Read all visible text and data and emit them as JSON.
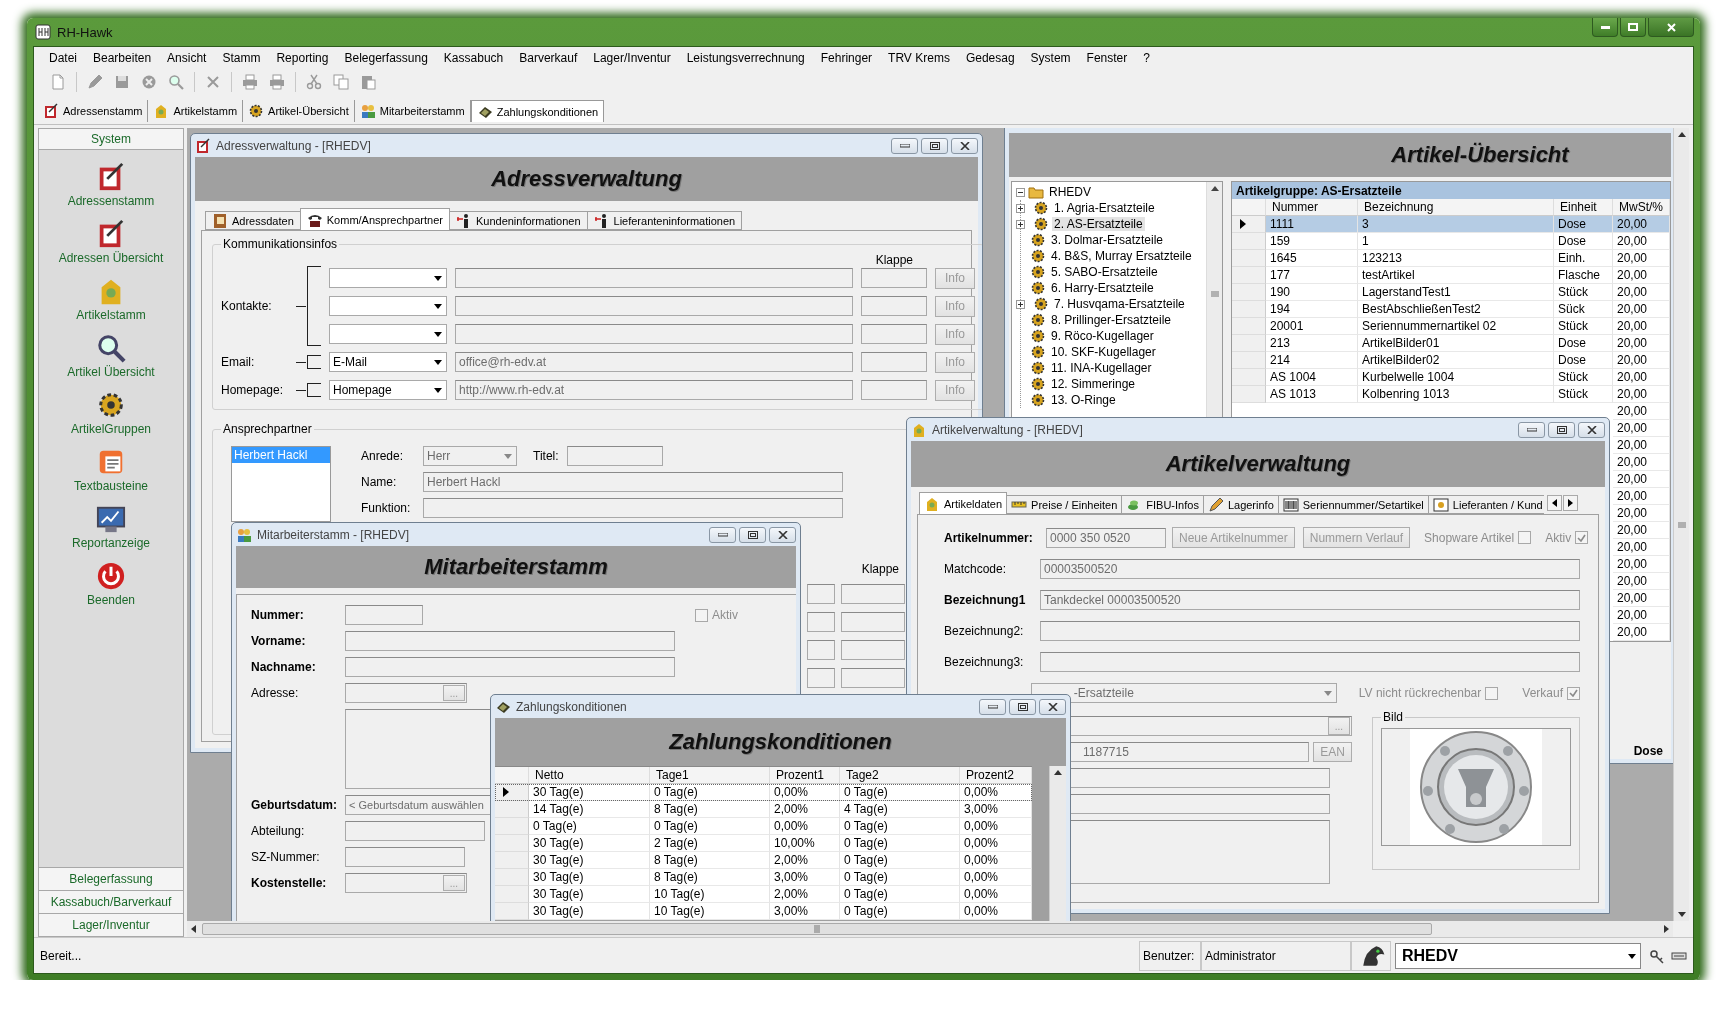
{
  "window": {
    "title": "RH-Hawk"
  },
  "menu": [
    "Datei",
    "Bearbeiten",
    "Ansicht",
    "Stamm",
    "Reporting",
    "Belegerfassung",
    "Kassabuch",
    "Barverkauf",
    "Lager/Inventur",
    "Leistungsverrechnung",
    "Fehringer",
    "TRV Krems",
    "Gedesag",
    "System",
    "Fenster",
    "?"
  ],
  "doc_tabs": [
    {
      "label": "Adressenstamm",
      "kind": "address",
      "selected": false
    },
    {
      "label": "Artikelstamm",
      "kind": "article",
      "selected": false
    },
    {
      "label": "Artikel-Übersicht",
      "kind": "gears",
      "selected": false
    },
    {
      "label": "Mitarbeiterstamm",
      "kind": "staff",
      "selected": false
    },
    {
      "label": "Zahlungskonditionen",
      "kind": "cash",
      "selected": true
    }
  ],
  "sidebar": {
    "header": "System",
    "items": [
      {
        "label": "Adressenstamm",
        "kind": "address"
      },
      {
        "label": "Adressen Übersicht",
        "kind": "address"
      },
      {
        "label": "Artikelstamm",
        "kind": "article"
      },
      {
        "label": "Artikel Übersicht",
        "kind": "search"
      },
      {
        "label": "ArtikelGruppen",
        "kind": "gears"
      },
      {
        "label": "Textbausteine",
        "kind": "text"
      },
      {
        "label": "Reportanzeige",
        "kind": "report"
      },
      {
        "label": "Beenden",
        "kind": "power"
      }
    ],
    "sections": [
      "Belegerfassung",
      "Kassabuch/Barverkauf",
      "Lager/Inventur"
    ]
  },
  "adress_window": {
    "title": "Adressverwaltung - [RHEDV]",
    "heading": "Adressverwaltung",
    "tabs": [
      {
        "label": "Adressdaten",
        "kind": "book",
        "selected": false
      },
      {
        "label": "Komm/Ansprechpartner",
        "kind": "phone",
        "selected": true
      },
      {
        "label": "Kundeninformationen",
        "kind": "person",
        "selected": false
      },
      {
        "label": "Lieferanteninformationen",
        "kind": "person",
        "selected": false
      }
    ],
    "komm": {
      "legend": "Kommunikationsinfos",
      "klappe": "Klappe",
      "kontakte_label": "Kontakte:",
      "rows": [
        {
          "kind": "contact",
          "button": "Info"
        },
        {
          "kind": "contact",
          "button": "Info"
        },
        {
          "kind": "contact",
          "button": "Info"
        },
        {
          "kind": "single",
          "label": "Email:",
          "combo": "E-Mail",
          "value": "office@rh-edv.at",
          "button": "Info"
        },
        {
          "kind": "single",
          "label": "Homepage:",
          "combo": "Homepage",
          "value": "http://www.rh-edv.at",
          "button": "Info"
        }
      ]
    },
    "ansprechpartner": {
      "legend": "Ansprechpartner",
      "contacts": [
        {
          "label": "Herbert Hackl",
          "selected": true
        }
      ],
      "anrede_label": "Anrede:",
      "anrede": "Herr",
      "titel_label": "Titel:",
      "name_label": "Name:",
      "name": "Herbert Hackl",
      "funktion_label": "Funktion:",
      "klappe": "Klappe"
    }
  },
  "uebersicht_window": {
    "heading": "Artikel-Übersicht",
    "tree": {
      "label": "RHEDV",
      "expanded": true,
      "children": [
        {
          "label": "1. Agria-Ersatzteile",
          "expandable": true,
          "selected": false
        },
        {
          "label": "2. AS-Ersatzteile",
          "expandable": true,
          "selected": true
        },
        {
          "label": "3. Dolmar-Ersatzteile",
          "expandable": false,
          "selected": false
        },
        {
          "label": "4. B&S, Murray Ersatzteile",
          "expandable": false,
          "selected": false
        },
        {
          "label": "5. SABO-Ersatzteile",
          "expandable": false,
          "selected": false
        },
        {
          "label": "6. Harry-Ersatzteile",
          "expandable": false,
          "selected": false
        },
        {
          "label": "7. Husvqama-Ersatzteile",
          "expandable": true,
          "selected": false
        },
        {
          "label": "8. Prillinger-Ersatzteile",
          "expandable": false,
          "selected": false
        },
        {
          "label": "9. Röco-Kugellager",
          "expandable": false,
          "selected": false
        },
        {
          "label": "10. SKF-Kugellager",
          "expandable": false,
          "selected": false
        },
        {
          "label": "11. INA-Kugellager",
          "expandable": false,
          "selected": false
        },
        {
          "label": "12. Simmeringe",
          "expandable": false,
          "selected": false
        },
        {
          "label": "13. O-Ringe",
          "expandable": false,
          "selected": false
        }
      ]
    },
    "group_title": "Artikelgruppe: AS-Ersatzteile",
    "columns": [
      "Nummer",
      "Bezeichnung",
      "Einheit",
      "MwSt/%"
    ],
    "rows": [
      {
        "nummer": "1111",
        "bezeichnung": "3",
        "einheit": "Dose",
        "mwst": "20,00",
        "selected": true
      },
      {
        "nummer": "159",
        "bezeichnung": "1",
        "einheit": "Dose",
        "mwst": "20,00",
        "selected": false
      },
      {
        "nummer": "1645",
        "bezeichnung": "123213",
        "einheit": "Einh.",
        "mwst": "20,00",
        "selected": false
      },
      {
        "nummer": "177",
        "bezeichnung": "testArtikel",
        "einheit": "Flasche",
        "mwst": "20,00",
        "selected": false
      },
      {
        "nummer": "190",
        "bezeichnung": "LagerstandTest1",
        "einheit": "Stück",
        "mwst": "20,00",
        "selected": false
      },
      {
        "nummer": "194",
        "bezeichnung": "BestAbschließenTest2",
        "einheit": "Sück",
        "mwst": "20,00",
        "selected": false
      },
      {
        "nummer": "20001",
        "bezeichnung": "Seriennummernartikel 02",
        "einheit": "Stück",
        "mwst": "20,00",
        "selected": false
      },
      {
        "nummer": "213",
        "bezeichnung": "ArtikelBilder01",
        "einheit": "Dose",
        "mwst": "20,00",
        "selected": false
      },
      {
        "nummer": "214",
        "bezeichnung": "ArtikelBilder02",
        "einheit": "Dose",
        "mwst": "20,00",
        "selected": false
      },
      {
        "nummer": "AS 1004",
        "bezeichnung": "Kurbelwelle 1004",
        "einheit": "Stück",
        "mwst": "20,00",
        "selected": false
      },
      {
        "nummer": "AS 1013",
        "bezeichnung": "Kolbenring 1013",
        "einheit": "Stück",
        "mwst": "20,00",
        "selected": false
      },
      {
        "mwst": "20,00",
        "selected": false
      },
      {
        "mwst": "20,00",
        "selected": false
      },
      {
        "mwst": "20,00",
        "selected": false
      },
      {
        "mwst": "20,00",
        "selected": false
      },
      {
        "mwst": "20,00",
        "selected": false
      },
      {
        "mwst": "20,00",
        "selected": false
      },
      {
        "mwst": "20,00",
        "selected": false
      },
      {
        "mwst": "20,00",
        "selected": false
      },
      {
        "mwst": "20,00",
        "selected": false
      },
      {
        "mwst": "20,00",
        "selected": false
      },
      {
        "mwst": "20,00",
        "selected": false
      },
      {
        "mwst": "20,00",
        "selected": false
      },
      {
        "mwst": "20,00",
        "selected": false
      },
      {
        "mwst": "20,00",
        "selected": false
      }
    ],
    "footer": "Dose"
  },
  "mitarbeiter_window": {
    "title": "Mitarbeiterstamm - [RHEDV]",
    "heading": "Mitarbeiterstamm",
    "aktiv": {
      "label": "Aktiv",
      "checked": false
    },
    "fields": [
      {
        "label": "Nummer:",
        "bold": true,
        "kind": "short"
      },
      {
        "label": "Vorname:",
        "bold": true,
        "kind": "wide"
      },
      {
        "label": "Nachname:",
        "bold": true,
        "kind": "wide"
      },
      {
        "label": "Adresse:",
        "bold": false,
        "kind": "lookup",
        "button": "..."
      },
      {
        "kind": "memo"
      },
      {
        "label": "Geburtsdatum:",
        "bold": true,
        "kind": "date",
        "value": "< Geburtsdatum auswählen"
      },
      {
        "label": "Abteilung:",
        "bold": false,
        "kind": "wide"
      },
      {
        "label": "SZ-Nummer:",
        "bold": false,
        "kind": "short"
      },
      {
        "label": "Kostenstelle:",
        "bold": true,
        "kind": "lookup",
        "button": "..."
      }
    ]
  },
  "artikel_window": {
    "title": "Artikelverwaltung - [RHEDV]",
    "heading": "Artikelverwaltung",
    "tabs": [
      {
        "label": "Artikeldaten",
        "kind": "article",
        "selected": true
      },
      {
        "label": "Preise / Einheiten",
        "kind": "ruler",
        "selected": false
      },
      {
        "label": "FIBU-Infos",
        "kind": "coins",
        "selected": false
      },
      {
        "label": "Lagerinfo",
        "kind": "pencil",
        "selected": false
      },
      {
        "label": "Seriennummer/Setartikel",
        "kind": "barcode",
        "selected": false
      },
      {
        "label": "Lieferanten / Kund",
        "kind": "frame",
        "selected": false
      }
    ],
    "artikelnummer": {
      "label": "Artikelnummer:",
      "value": "0000 350 0520"
    },
    "buttons": [
      "Neue Artikelnummer",
      "Nummern Verlauf"
    ],
    "flags": [
      {
        "label": "Shopware Artikel",
        "checked": false
      },
      {
        "label": "Aktiv",
        "checked": true
      }
    ],
    "fields": [
      {
        "label": "Matchcode:",
        "value": "00003500520",
        "bold": false
      },
      {
        "label": "Bezeichnung1",
        "value": "Tankdeckel 00003500520",
        "bold": true
      },
      {
        "label": "Bezeichnung2:",
        "bold": false
      },
      {
        "label": "Bezeichnung3:",
        "bold": false
      }
    ],
    "gruppe": "-Ersatzteile",
    "flags2": [
      {
        "label": "LV nicht rückrechenbar",
        "checked": false
      },
      {
        "label": "Verkauf",
        "checked": true
      }
    ],
    "lookup_button": "...",
    "ean": {
      "value": "1187715",
      "button": "EAN"
    },
    "bild": {
      "legend": "Bild",
      "kind": "picture"
    }
  },
  "zahlungs_window": {
    "title": "Zahlungskonditionen",
    "heading": "Zahlungskonditionen",
    "columns": [
      "Netto",
      "Tage1",
      "Prozent1",
      "Tage2",
      "Prozent2"
    ],
    "rows": [
      {
        "cells": [
          "30 Tag(e)",
          "0 Tag(e)",
          "0,00%",
          "0 Tag(e)",
          "0,00%"
        ],
        "selected": true
      },
      {
        "cells": [
          "14 Tag(e)",
          "8 Tag(e)",
          "2,00%",
          "4 Tag(e)",
          "3,00%"
        ],
        "selected": false
      },
      {
        "cells": [
          "0 Tag(e)",
          "0 Tag(e)",
          "0,00%",
          "0 Tag(e)",
          "0,00%"
        ],
        "selected": false
      },
      {
        "cells": [
          "30 Tag(e)",
          "2 Tag(e)",
          "10,00%",
          "0 Tag(e)",
          "0,00%"
        ],
        "selected": false
      },
      {
        "cells": [
          "30 Tag(e)",
          "8 Tag(e)",
          "2,00%",
          "0 Tag(e)",
          "0,00%"
        ],
        "selected": false
      },
      {
        "cells": [
          "30 Tag(e)",
          "8 Tag(e)",
          "3,00%",
          "0 Tag(e)",
          "0,00%"
        ],
        "selected": false
      },
      {
        "cells": [
          "30 Tag(e)",
          "10 Tag(e)",
          "2,00%",
          "0 Tag(e)",
          "0,00%"
        ],
        "selected": false
      },
      {
        "cells": [
          "30 Tag(e)",
          "10 Tag(e)",
          "3,00%",
          "0 Tag(e)",
          "0,00%"
        ],
        "selected": false
      }
    ]
  },
  "status_bar": {
    "text": "Bereit...",
    "user_label": "Benutzer:",
    "user": "Administrator",
    "mandant": "RHEDV"
  }
}
